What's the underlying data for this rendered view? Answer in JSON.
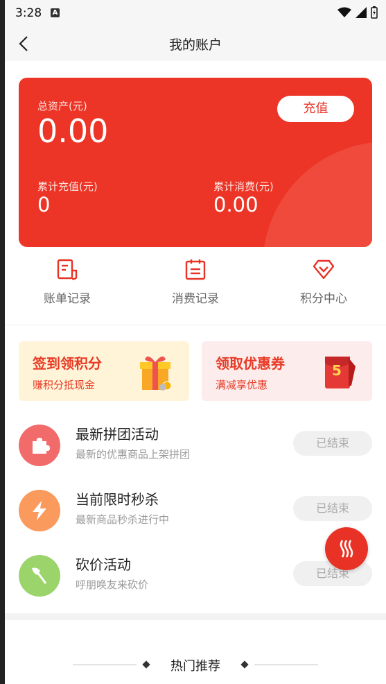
{
  "status": {
    "time": "3:28",
    "a_icon": "A"
  },
  "nav": {
    "title": "我的账户"
  },
  "account": {
    "total_label": "总资产(元)",
    "total_value": "0.00",
    "recharge_label": "充值",
    "cum_recharge_label": "累计充值(元)",
    "cum_recharge_value": "0",
    "cum_spend_label": "累计消费(元)",
    "cum_spend_value": "0.00"
  },
  "quick_links": [
    {
      "label": "账单记录",
      "icon": "bill-icon"
    },
    {
      "label": "消费记录",
      "icon": "calendar-icon"
    },
    {
      "label": "积分中心",
      "icon": "diamond-icon"
    }
  ],
  "promos": [
    {
      "title": "签到领积分",
      "subtitle": "赚积分抵现金",
      "icon": "gift-icon"
    },
    {
      "title": "领取优惠券",
      "subtitle": "满减享优惠",
      "icon": "red-packet-icon",
      "badge": "5"
    }
  ],
  "activities": [
    {
      "title": "最新拼团活动",
      "subtitle": "最新的优惠商品上架拼团",
      "button": "已结束",
      "icon": "puzzle-icon",
      "color": "#f26b6b"
    },
    {
      "title": "当前限时秒杀",
      "subtitle": "最新商品秒杀进行中",
      "button": "已结束",
      "icon": "lightning-icon",
      "color": "#fb9a5d"
    },
    {
      "title": "砍价活动",
      "subtitle": "呼朋唤友来砍价",
      "button": "已结束",
      "icon": "axe-icon",
      "color": "#9bd46b"
    }
  ],
  "hot": {
    "title": "热门推荐"
  },
  "colors": {
    "brand": "#ec3526",
    "promo1_bg": "#fff4d8",
    "promo2_bg": "#fdecec"
  }
}
